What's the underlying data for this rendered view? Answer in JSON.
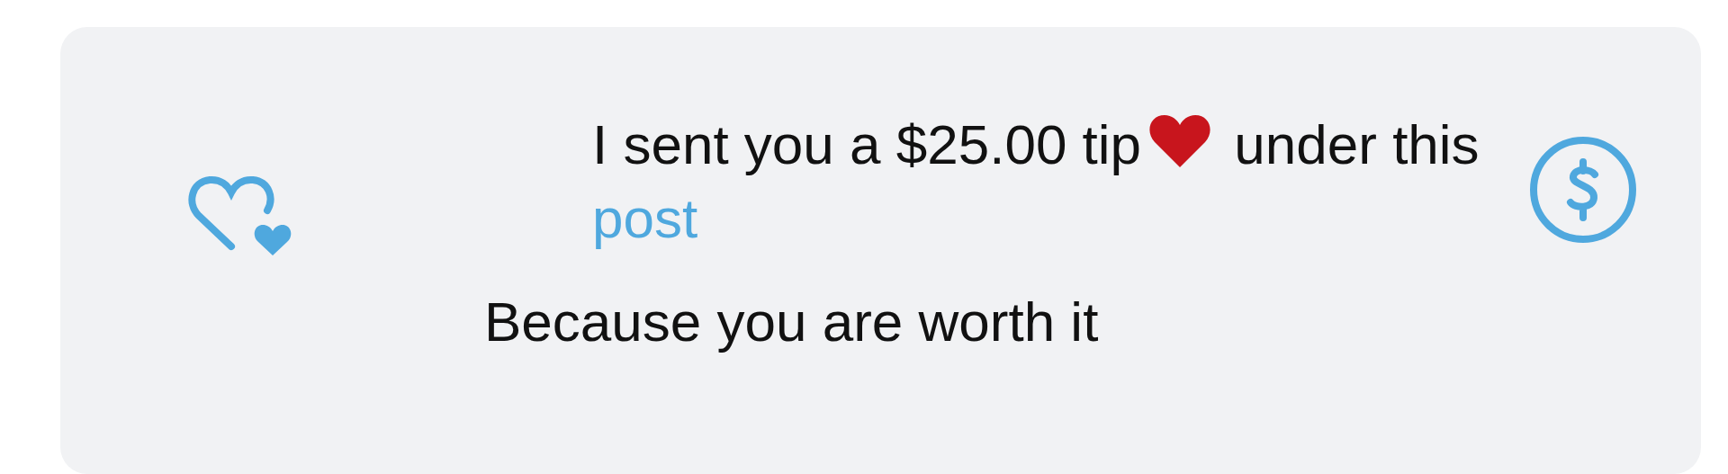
{
  "tip_message": {
    "text_before": "I sent you a $25.00 tip",
    "text_after": "under this",
    "link": "post"
  },
  "note": "Because you are worth it"
}
